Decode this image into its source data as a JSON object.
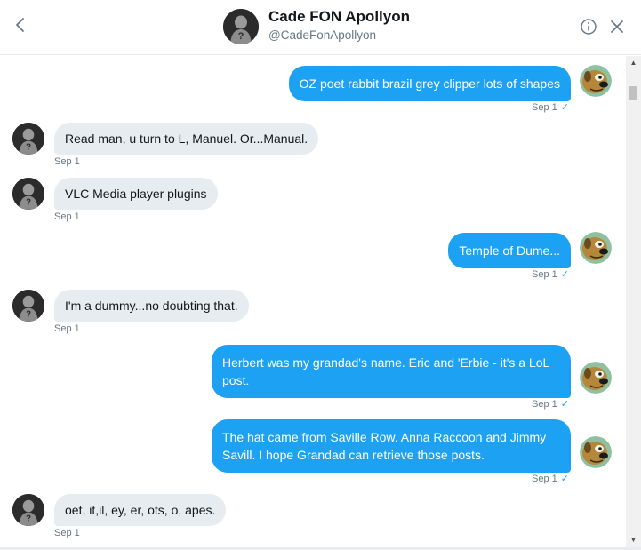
{
  "header": {
    "name": "Cade FON Apollyon",
    "handle": "@CadeFonApollyon"
  },
  "icons": {
    "back": "chevron-left-icon",
    "info": "info-circle-icon",
    "close": "close-icon"
  },
  "colors": {
    "accent": "#1da1f2",
    "incoming_bubble": "#e6ecf0",
    "secondary_text": "#657786"
  },
  "messages": [
    {
      "direction": "out",
      "text": "OZ poet rabbit brazil grey clipper lots of shapes",
      "date": "Sep 1",
      "read": true
    },
    {
      "direction": "in",
      "text": "Read man, u turn to L, Manuel. Or...Manual.",
      "date": "Sep 1"
    },
    {
      "direction": "in",
      "text": "VLC Media player plugins",
      "date": "Sep 1"
    },
    {
      "direction": "out",
      "text": "Temple of Dume...",
      "date": "Sep 1",
      "read": true
    },
    {
      "direction": "in",
      "text": "I'm a dummy...no doubting that.",
      "date": "Sep 1"
    },
    {
      "direction": "out",
      "text": "Herbert was my grandad's name. Eric and 'Erbie - it's a LoL post.",
      "date": "Sep 1",
      "read": true
    },
    {
      "direction": "out",
      "text": "The hat came from Saville Row. Anna Raccoon and Jimmy Savill. I hope Grandad can retrieve those posts.",
      "date": "Sep 1",
      "read": true
    },
    {
      "direction": "in",
      "text": "oet, it,il, ey, er, ots, o, apes.",
      "date": "Sep 1"
    }
  ]
}
